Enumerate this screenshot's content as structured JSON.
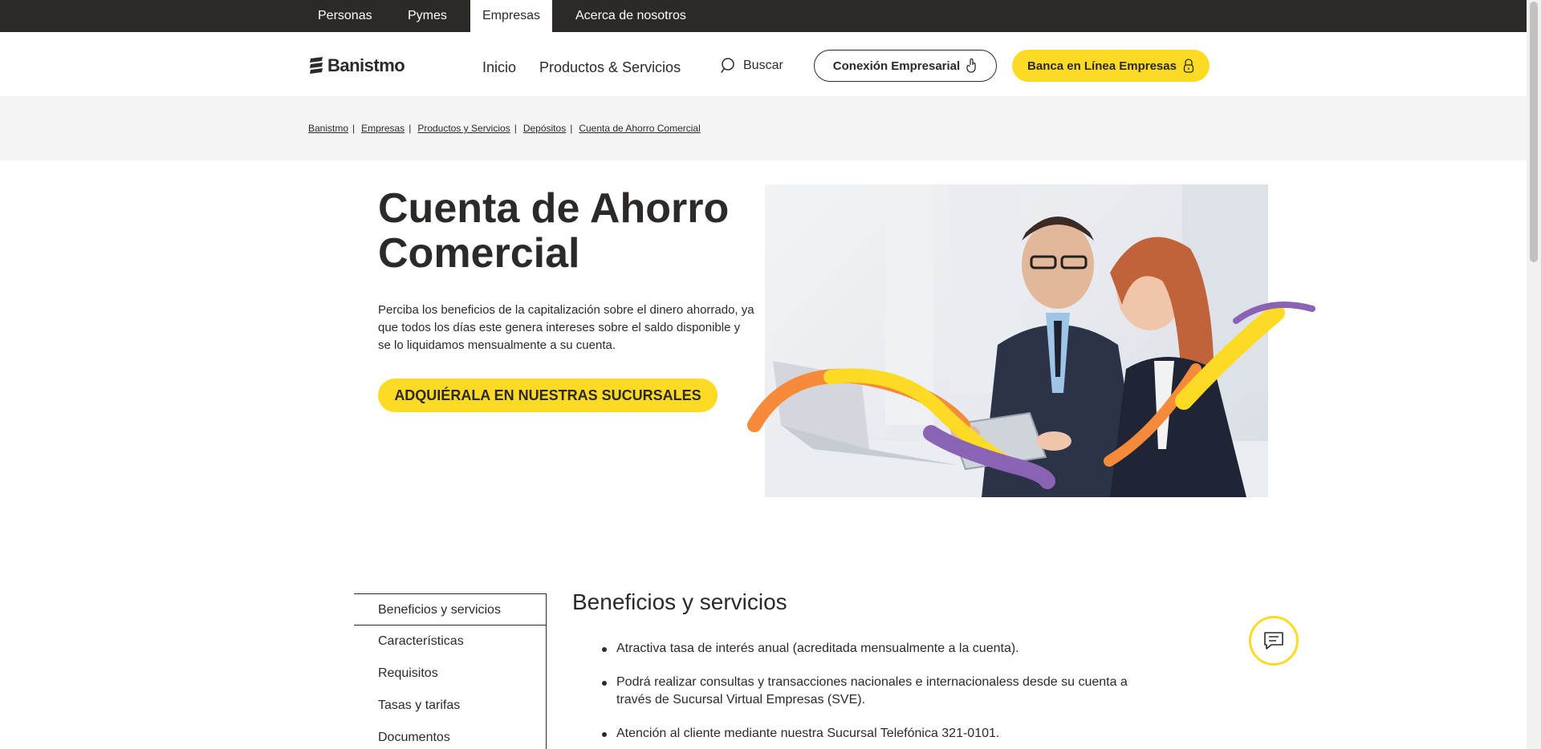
{
  "topbar": {
    "tabs": [
      {
        "label": "Personas",
        "active": false
      },
      {
        "label": "Pymes",
        "active": false
      },
      {
        "label": "Empresas",
        "active": true
      },
      {
        "label": "Acerca de nosotros",
        "active": false
      }
    ]
  },
  "header": {
    "logo_text": "Banistmo",
    "nav": [
      {
        "label": "Inicio"
      },
      {
        "label": "Productos & Servicios"
      }
    ],
    "search_label": "Buscar",
    "conexion_label": "Conexión Empresarial",
    "banca_label": "Banca en Línea Empresas"
  },
  "breadcrumb": [
    "Banistmo",
    "Empresas",
    "Productos y Servicios",
    "Depósitos",
    "Cuenta de Ahorro Comercial"
  ],
  "hero": {
    "title": "Cuenta de Ahorro Comercial",
    "description": "Perciba los beneficios de la capitalización sobre el dinero ahorrado, ya que todos los días este genera intereses sobre el saldo disponible y se lo liquidamos mensualmente a su cuenta.",
    "cta_label": "ADQUIÉRALA EN NUESTRAS SUCURSALES"
  },
  "sidenav": {
    "items": [
      {
        "label": "Beneficios y servicios",
        "active": true
      },
      {
        "label": "Características",
        "active": false
      },
      {
        "label": "Requisitos",
        "active": false
      },
      {
        "label": "Tasas y tarifas",
        "active": false
      },
      {
        "label": "Documentos",
        "active": false
      }
    ]
  },
  "content": {
    "title": "Beneficios y servicios",
    "items": [
      "Atractiva tasa de interés anual (acreditada mensualmente a la cuenta).",
      "Podrá realizar consultas y transacciones nacionales e internacionaless desde su cuenta a través de Sucursal Virtual Empresas (SVE).",
      "Atención al cliente mediante nuestra Sucursal Telefónica 321-0101."
    ]
  },
  "colors": {
    "brand_yellow": "#fdda24",
    "dark": "#2c2a29",
    "breadcrumb_bg": "#f4f4f4",
    "wave_orange": "#f58a3a",
    "wave_purple": "#8a63b5"
  },
  "icons": {
    "search": "search-icon",
    "conexion": "hand-pointer-icon",
    "banca": "lock-icon",
    "chat": "chat-icon"
  }
}
